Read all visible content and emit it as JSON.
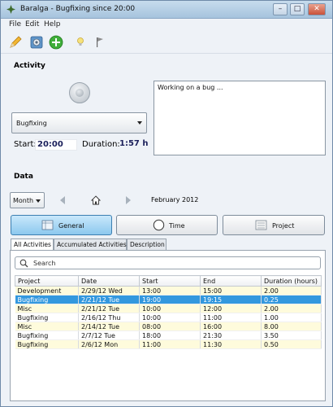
{
  "window": {
    "title": "Baralga - Bugfixing since 20:00",
    "minimize": "–",
    "maximize": "□",
    "close": "✕"
  },
  "menu": {
    "file": "File",
    "edit": "Edit",
    "help": "Help"
  },
  "toolbar": {
    "icons": [
      "edit-pencil-icon",
      "settings-icon",
      "add-activity-icon",
      "lightbulb-icon",
      "flag-icon"
    ]
  },
  "activity": {
    "heading": "Activity",
    "project": "Bugfixing",
    "description": "Working on a bug ...",
    "start_label": "Start:",
    "start_value": "20:00",
    "duration_label": "Duration:",
    "duration_value": "1:57 h"
  },
  "data_section": {
    "heading": "Data",
    "period": "Month",
    "month": "February 2012",
    "buttons": [
      {
        "label": "General",
        "selected": true
      },
      {
        "label": "Time",
        "selected": false
      },
      {
        "label": "Project",
        "selected": false
      }
    ],
    "tabs": [
      "All Activities",
      "Accumulated Activities",
      "Description"
    ],
    "search_placeholder": "Search",
    "columns": [
      "Project",
      "Date",
      "Start",
      "End",
      "Duration (hours)"
    ],
    "rows": [
      [
        "Development",
        "2/29/12 Wed",
        "13:00",
        "15:00",
        "2.00"
      ],
      [
        "Bugfixing",
        "2/21/12 Tue",
        "19:00",
        "19:15",
        "0.25"
      ],
      [
        "Misc",
        "2/21/12 Tue",
        "10:00",
        "12:00",
        "2.00"
      ],
      [
        "Bugfixing",
        "2/16/12 Thu",
        "10:00",
        "11:00",
        "1.00"
      ],
      [
        "Misc",
        "2/14/12 Tue",
        "08:00",
        "16:00",
        "8.00"
      ],
      [
        "Bugfixing",
        "2/7/12 Tue",
        "18:00",
        "21:30",
        "3.50"
      ],
      [
        "Bugfixing",
        "2/6/12 Mon",
        "11:00",
        "11:30",
        "0.50"
      ]
    ],
    "selected_row": 1
  },
  "colors": {
    "selection": "#3398de",
    "odd_row": "#fefbdc",
    "value_text": "#1a1f5a",
    "selected_button": "#8cc8ee"
  }
}
